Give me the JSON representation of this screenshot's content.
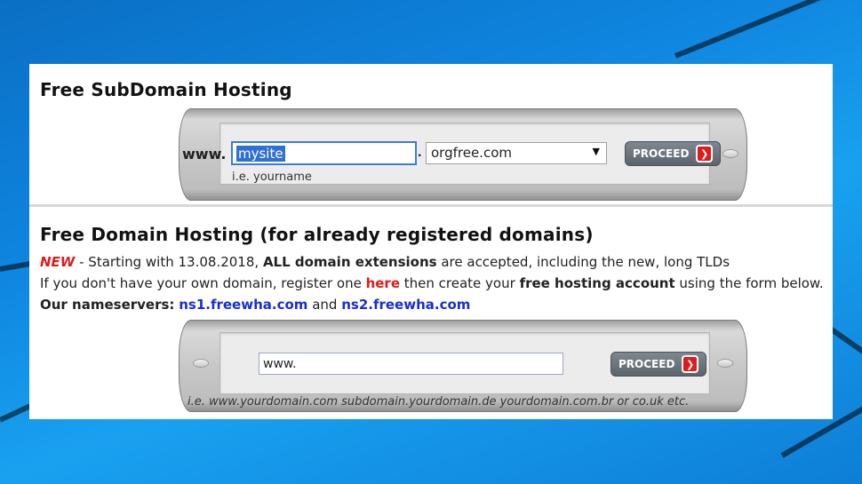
{
  "subdomain": {
    "title": "Free SubDomain Hosting",
    "www_label": "www.",
    "name_value": "mysite",
    "dot": ".",
    "domain_selected": "orgfree.com",
    "proceed_label": "PROCEED",
    "hint": "i.e. yourname"
  },
  "domain": {
    "title": "Free Domain Hosting (for already registered domains)",
    "new_tag": "NEW",
    "line1_a": " - Starting with 13.08.2018, ",
    "line1_b": "ALL domain extensions",
    "line1_c": " are accepted, including the new, long TLDs",
    "line2_a": "If you don't have your own domain, register one ",
    "line2_link": "here",
    "line2_b": " then create your ",
    "line2_c": "free hosting account",
    "line2_d": " using the form below.",
    "ns_label": "Our nameservers:",
    "ns1": "ns1.freewha.com",
    "ns_and": "and",
    "ns2": "ns2.freewha.com",
    "input_value": "www.",
    "proceed_label": "PROCEED",
    "hint_prefix": "i.e.",
    "hint_examples": "i.e. www.yourdomain.com subdomain.yourdomain.de yourdomain.com.br or co.uk etc."
  },
  "icons": {
    "proceed_arrow": "chevron-right-icon",
    "select_arrow": "triangle-down-icon"
  },
  "colors": {
    "accent_red": "#e01b1b",
    "link_blue": "#1a2fd0",
    "selection_blue": "#2f6fd6"
  }
}
